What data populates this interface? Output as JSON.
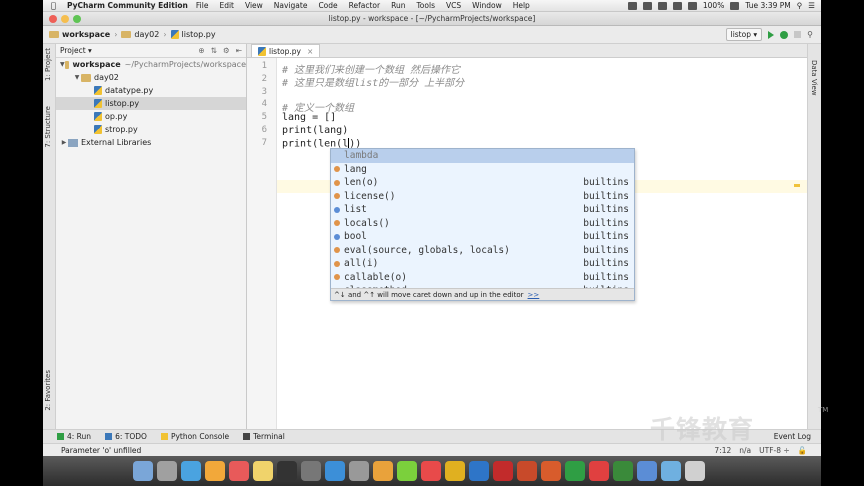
{
  "menubar": {
    "app_name": "PyCharm Community Edition",
    "items": [
      "File",
      "Edit",
      "View",
      "Navigate",
      "Code",
      "Refactor",
      "Run",
      "Tools",
      "VCS",
      "Window",
      "Help"
    ],
    "battery": "100%",
    "clock": "Tue 3:39 PM"
  },
  "window": {
    "title": "listop.py - workspace - [~/PycharmProjects/workspace]"
  },
  "breadcrumb": [
    "workspace",
    "day02",
    "listop.py"
  ],
  "run_config": "listop",
  "project_panel": {
    "header": "Project",
    "tree": [
      {
        "label": "workspace",
        "detail": "~/PycharmProjects/workspace",
        "type": "folder",
        "level": 0,
        "expanded": true
      },
      {
        "label": "day02",
        "type": "folder",
        "level": 1,
        "expanded": true
      },
      {
        "label": "datatype.py",
        "type": "py",
        "level": 2
      },
      {
        "label": "listop.py",
        "type": "py",
        "level": 2,
        "selected": true
      },
      {
        "label": "op.py",
        "type": "py",
        "level": 2
      },
      {
        "label": "strop.py",
        "type": "py",
        "level": 2
      },
      {
        "label": "External Libraries",
        "type": "lib",
        "level": 0,
        "expanded": false
      }
    ]
  },
  "side_tabs": {
    "project": "1: Project",
    "structure": "7: Structure",
    "favorites": "2: Favorites",
    "data_view": "Data View"
  },
  "editor": {
    "tab_label": "listop.py",
    "lines": [
      {
        "num": "1",
        "text": "# 这里我们来创建一个数组 然后操作它",
        "kind": "comment"
      },
      {
        "num": "2",
        "text": "# 这里只是数组list的一部分 上半部分",
        "kind": "comment"
      },
      {
        "num": "3",
        "text": "",
        "kind": "code"
      },
      {
        "num": "4",
        "text": "# 定义一个数组",
        "kind": "comment"
      },
      {
        "num": "5",
        "text": "lang = []",
        "kind": "code"
      },
      {
        "num": "6",
        "text": "print(lang)",
        "kind": "code"
      },
      {
        "num": "7",
        "text": "print(len(l))",
        "kind": "code"
      }
    ],
    "line7_before_caret": "print(len(l",
    "line7_after_caret": "))"
  },
  "completion": {
    "items": [
      {
        "name": "lambda",
        "source": "",
        "dot_color": "",
        "selected": true
      },
      {
        "name": "lang",
        "source": "",
        "dot_color": "#e0944a"
      },
      {
        "name": "len(o)",
        "source": "builtins",
        "dot_color": "#e0944a"
      },
      {
        "name": "license()",
        "source": "builtins",
        "dot_color": "#e0944a"
      },
      {
        "name": "list",
        "source": "builtins",
        "dot_color": "#5b8dd6"
      },
      {
        "name": "locals()",
        "source": "builtins",
        "dot_color": "#e0944a"
      },
      {
        "name": "bool",
        "source": "builtins",
        "dot_color": "#5b8dd6"
      },
      {
        "name": "eval(source, globals, locals)",
        "source": "builtins",
        "dot_color": "#e0944a"
      },
      {
        "name": "all(i)",
        "source": "builtins",
        "dot_color": "#e0944a"
      },
      {
        "name": "callable(o)",
        "source": "builtins",
        "dot_color": "#e0944a"
      },
      {
        "name": "classmethod",
        "source": "builtins",
        "dot_color": "#5b8dd6"
      }
    ],
    "footer": "^↓ and ^↑ will move caret down and up in the editor",
    "footer_link": ">>"
  },
  "bottom_tabs": [
    {
      "label": "4: Run",
      "icon_color": "#2f9e44"
    },
    {
      "label": "6: TODO",
      "icon_color": "#3b78b9"
    },
    {
      "label": "Python Console",
      "icon_color": "#f1c232"
    },
    {
      "label": "Terminal",
      "icon_color": "#444444"
    }
  ],
  "event_log": "Event Log",
  "status": {
    "message": "Parameter 'o' unfilled",
    "position": "7:12",
    "na": "n/a",
    "encoding": "UTF-8 ÷"
  },
  "watermark": "千锋教育",
  "dock_colors": [
    "#7aa6d8",
    "#a0a0a0",
    "#4aa3e0",
    "#f2a83a",
    "#e85a5a",
    "#f0d36b",
    "#333333",
    "#777777",
    "#3c8fd8",
    "#999999",
    "#e9a23b",
    "#7bd03c",
    "#e84a4a",
    "#e0b020",
    "#2e75c8",
    "#c22b2b",
    "#c84a2a",
    "#d85c2c",
    "#2f9e44",
    "#e04040",
    "#3a8a3a",
    "#5b8dd6",
    "#6fb0e0",
    "#d0d0d0"
  ]
}
